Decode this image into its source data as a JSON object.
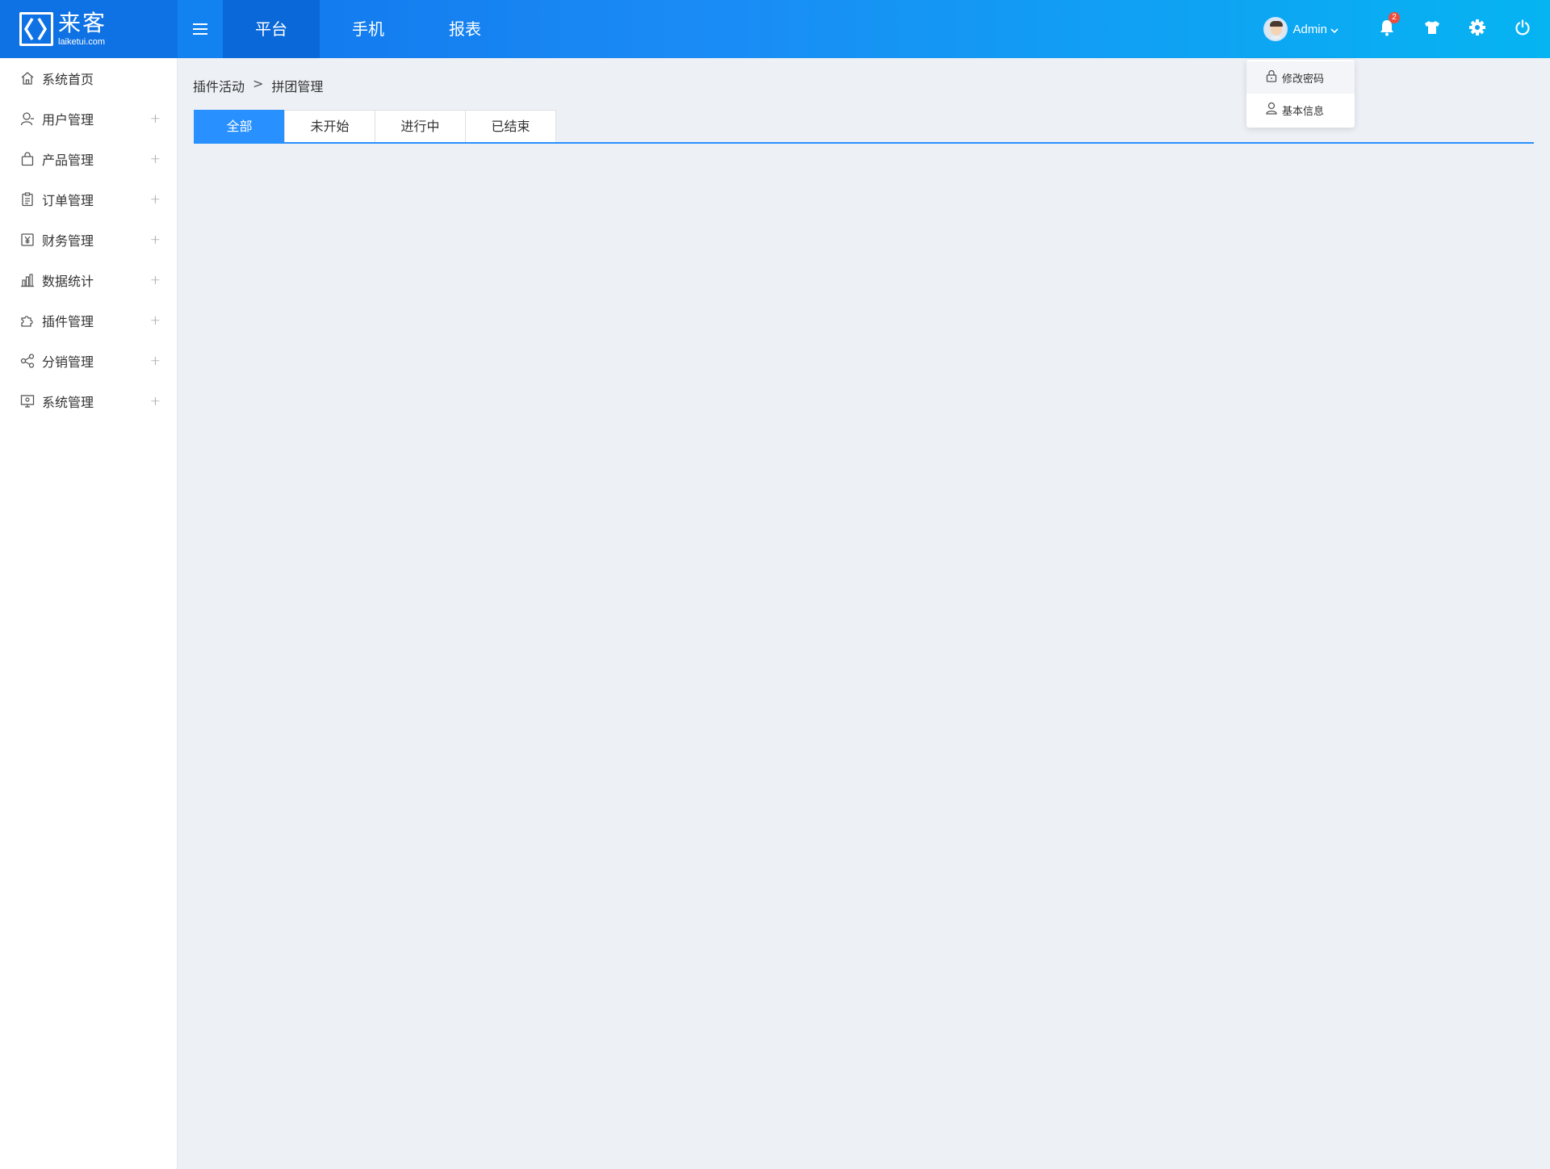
{
  "header": {
    "logo": {
      "cn": "来客",
      "en": "laiketui.com"
    },
    "nav": [
      {
        "label": "平台",
        "active": true
      },
      {
        "label": "手机",
        "active": false
      },
      {
        "label": "报表",
        "active": false
      }
    ],
    "user": {
      "name": "Admin"
    },
    "notifications": {
      "count": "2"
    },
    "icons": [
      "bell-icon",
      "tshirt-icon",
      "gear-icon",
      "power-icon"
    ]
  },
  "dropdown": {
    "items": [
      {
        "label": "修改密码",
        "icon": "lock-icon"
      },
      {
        "label": "基本信息",
        "icon": "user-icon"
      }
    ]
  },
  "sidebar": {
    "items": [
      {
        "label": "系统首页",
        "icon": "home-icon",
        "expandable": false
      },
      {
        "label": "用户管理",
        "icon": "user-icon",
        "expandable": true
      },
      {
        "label": "产品管理",
        "icon": "bag-icon",
        "expandable": true
      },
      {
        "label": "订单管理",
        "icon": "clipboard-icon",
        "expandable": true
      },
      {
        "label": "财务管理",
        "icon": "yuan-icon",
        "expandable": true
      },
      {
        "label": "数据统计",
        "icon": "bar-chart-icon",
        "expandable": true
      },
      {
        "label": "插件管理",
        "icon": "puzzle-icon",
        "expandable": true
      },
      {
        "label": "分销管理",
        "icon": "share-icon",
        "expandable": true
      },
      {
        "label": "系统管理",
        "icon": "monitor-icon",
        "expandable": true
      }
    ],
    "plus": "+"
  },
  "breadcrumb": {
    "parent": "插件活动",
    "separator": ">",
    "current": "拼团管理"
  },
  "tabs": [
    {
      "label": "全部",
      "active": true
    },
    {
      "label": "未开始",
      "active": false
    },
    {
      "label": "进行中",
      "active": false
    },
    {
      "label": "已结束",
      "active": false
    }
  ],
  "colors": {
    "accent": "#2890ff",
    "header_start": "#0d6fea",
    "header_end": "#06b4f2",
    "badge": "#ee4d3d"
  }
}
